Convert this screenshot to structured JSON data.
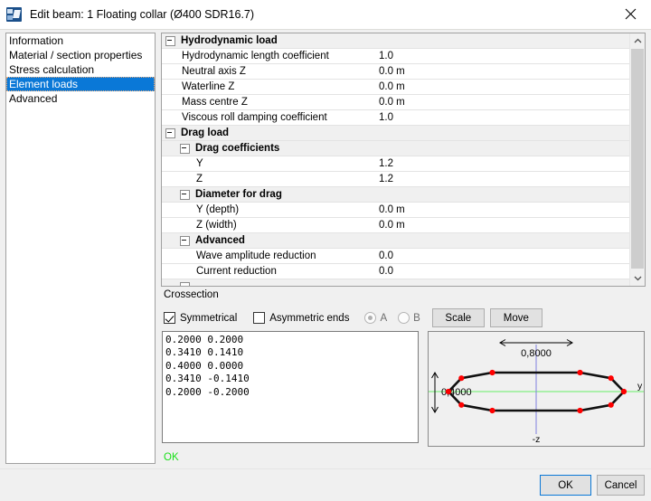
{
  "window": {
    "title": "Edit beam: 1 Floating collar (Ø400 SDR16.7)",
    "icon": "app-icon",
    "close_label": "✕"
  },
  "sidebar": {
    "items": [
      {
        "label": "Information",
        "selected": false
      },
      {
        "label": "Material / section properties",
        "selected": false
      },
      {
        "label": "Stress calculation",
        "selected": false
      },
      {
        "label": "Element loads",
        "selected": true
      },
      {
        "label": "Advanced",
        "selected": false
      }
    ]
  },
  "grid": {
    "rows": [
      {
        "kind": "category",
        "label": "Hydrodynamic load",
        "value": "",
        "expanded": true
      },
      {
        "kind": "item",
        "label": "Hydrodynamic length coefficient",
        "value": "1.0"
      },
      {
        "kind": "item",
        "label": "Neutral axis Z",
        "value": "0.0 m"
      },
      {
        "kind": "item",
        "label": "Waterline Z",
        "value": "0.0 m"
      },
      {
        "kind": "item",
        "label": "Mass centre Z",
        "value": "0.0 m"
      },
      {
        "kind": "item",
        "label": "Viscous roll damping coefficient",
        "value": "1.0"
      },
      {
        "kind": "category",
        "label": "Drag load",
        "value": "",
        "expanded": true
      },
      {
        "kind": "subcategory",
        "label": "Drag coefficients",
        "value": "",
        "expanded": true
      },
      {
        "kind": "deepitem",
        "label": "Y",
        "value": "1.2"
      },
      {
        "kind": "deepitem",
        "label": "Z",
        "value": "1.2"
      },
      {
        "kind": "subcategory",
        "label": "Diameter for drag",
        "value": "",
        "expanded": true
      },
      {
        "kind": "deepitem",
        "label": "Y (depth)",
        "value": "0.0 m"
      },
      {
        "kind": "deepitem",
        "label": "Z (width)",
        "value": "0.0 m"
      },
      {
        "kind": "subcategory",
        "label": "Advanced",
        "value": "",
        "expanded": true
      },
      {
        "kind": "deepitem",
        "label": "Wave amplitude reduction",
        "value": "0.0"
      },
      {
        "kind": "deepitem",
        "label": "Current reduction",
        "value": "0.0"
      },
      {
        "kind": "subcategory",
        "label": "",
        "value": "",
        "expanded": true
      }
    ],
    "scrollbar": {
      "up_arrow": "⌃",
      "down_arrow": "⌄"
    }
  },
  "crossection": {
    "section_label": "Crossection",
    "symmetrical": {
      "label": "Symmetrical",
      "checked": true
    },
    "asymmetric_ends": {
      "label": "Asymmetric ends",
      "checked": false
    },
    "radio_a": {
      "label": "A",
      "selected": true,
      "disabled": true
    },
    "radio_b": {
      "label": "B",
      "selected": false,
      "disabled": true
    },
    "scale_button": "Scale",
    "move_button": "Move",
    "coordinates": "0.2000 0.2000\n0.3410 0.1410\n0.4000 0.0000\n0.3410 -0.1410\n0.2000 -0.2000",
    "status": "OK"
  },
  "diagram": {
    "width_dimension": "0,8000",
    "height_dimension": "0,4000",
    "axis_y_label": "y",
    "axis_z_label": "-z",
    "colors": {
      "axis_y": "#66ee66",
      "axis_z": "#8080e0",
      "outline": "#101010",
      "vertex": "#ff0000"
    },
    "vertices": [
      [
        0.2,
        0.2
      ],
      [
        0.341,
        0.141
      ],
      [
        0.4,
        0.0
      ],
      [
        0.341,
        -0.141
      ],
      [
        0.2,
        -0.2
      ],
      [
        -0.2,
        -0.2
      ],
      [
        -0.341,
        -0.141
      ],
      [
        -0.4,
        0.0
      ],
      [
        -0.341,
        0.141
      ],
      [
        -0.2,
        0.2
      ]
    ]
  },
  "footer": {
    "ok_label": "OK",
    "cancel_label": "Cancel"
  }
}
